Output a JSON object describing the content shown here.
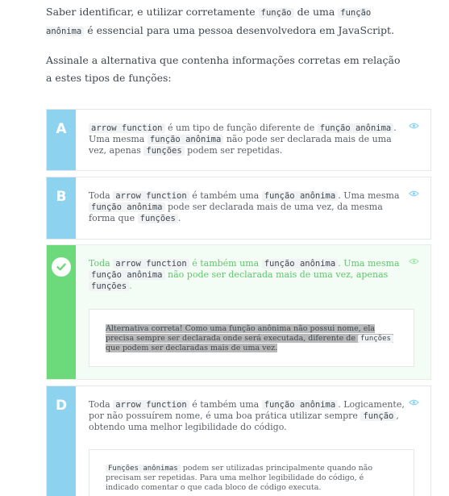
{
  "intro": {
    "p1_a": "Saber identificar, e utilizar corretamente ",
    "p1_code1": "função",
    "p1_b": " de uma ",
    "p1_code2": "função anônima",
    "p1_c": " é essencial para uma pessoa desenvolvedora em JavaScript.",
    "p2": "Assinale a alternativa que contenha informações corretas em relação a estes tipos de funções:"
  },
  "alternatives": [
    {
      "letter": "A",
      "parts": [
        "arrow function",
        " é um tipo de função diferente de ",
        "função anônima",
        ". Uma mesma ",
        "função anônima",
        " não pode ser declarada mais de uma vez, apenas ",
        "funções",
        " podem ser repetidas."
      ]
    },
    {
      "letter": "B",
      "parts": [
        "Toda ",
        "arrow function",
        " é também uma ",
        "função anônima",
        ". Uma mesma ",
        "função anônima",
        " pode ser declarada mais de uma vez, da mesma forma que ",
        "funções",
        "."
      ]
    },
    {
      "letter": "C",
      "state": "correct",
      "parts": [
        "Toda ",
        "arrow function",
        " é também uma ",
        "função anônima",
        ". Uma mesma ",
        "função anônima",
        " não pode ser declarada mais de uma vez, apenas ",
        "funções",
        "."
      ],
      "explanation": {
        "a": "Alternativa correta! Como uma função anônima não possui nome, ela precisa sempre ser declarada onde será executada, diferente de ",
        "code": "funções",
        "b": " que podem ser declaradas mais de uma vez."
      }
    },
    {
      "letter": "D",
      "parts": [
        "Toda ",
        "arrow function",
        " é também uma ",
        "função anônima",
        ". Logicamente, por não possuírem nome, é uma boa prática utilizar sempre ",
        "função",
        ", obtendo uma melhor legibilidade do código."
      ],
      "explanation": {
        "code": "Funções anônimas",
        "a": " podem ser utilizadas principalmente quando não precisam ser repetidas. Para uma melhor legibilidade do código, é indicado comentar o que cada bloco de código executa."
      }
    }
  ],
  "colors": {
    "letter_bg": "#8dd3ef",
    "correct_bg": "#6cd97b",
    "correct_text": "#5ec66b"
  },
  "icons": {
    "eye": "eye-icon",
    "check": "check-icon"
  }
}
